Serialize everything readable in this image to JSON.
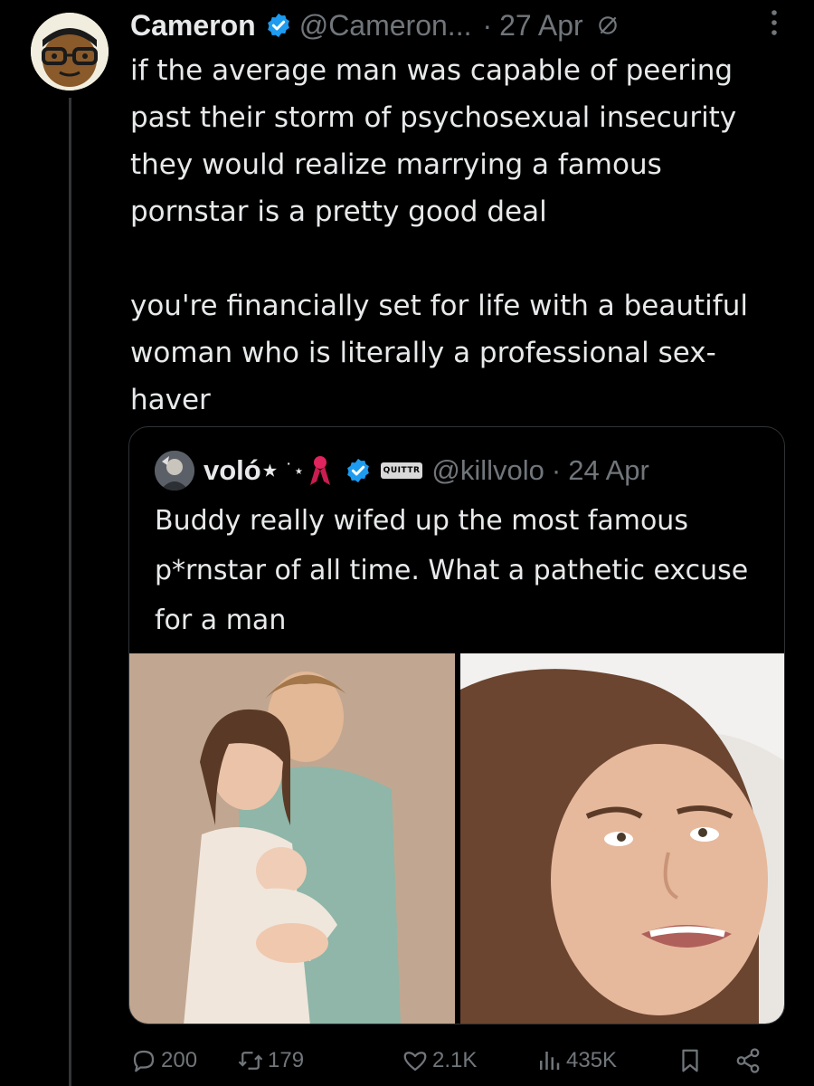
{
  "colors": {
    "background": "#000000",
    "text_primary": "#e7e9ea",
    "text_secondary": "#71767b",
    "verified_blue": "#1d9bf0",
    "border": "#2f3336"
  },
  "tweet": {
    "author": {
      "display_name": "Cameron",
      "handle": "@Cameron...",
      "verified": true
    },
    "separator": "·",
    "date": "27 Apr",
    "text_paragraphs": [
      "if the average man was capable of peering past their storm of psychosexual insecurity they would realize marrying a famous pornstar is a pretty good deal",
      "you're financially set for life with a beautiful woman who is literally a professional sex-haver"
    ],
    "quoted": {
      "display_name": "voló⋆",
      "name_decor": "˙⋆",
      "badge_text": "QUITTR",
      "handle": "@killvolo",
      "separator": "·",
      "date": "24 Apr",
      "text": "Buddy really wifed up the most famous p*rnstar of all time. What a pathetic excuse for a man"
    },
    "actions": {
      "replies": "200",
      "retweets": "179",
      "likes": "2.1K",
      "views": "435K"
    }
  }
}
